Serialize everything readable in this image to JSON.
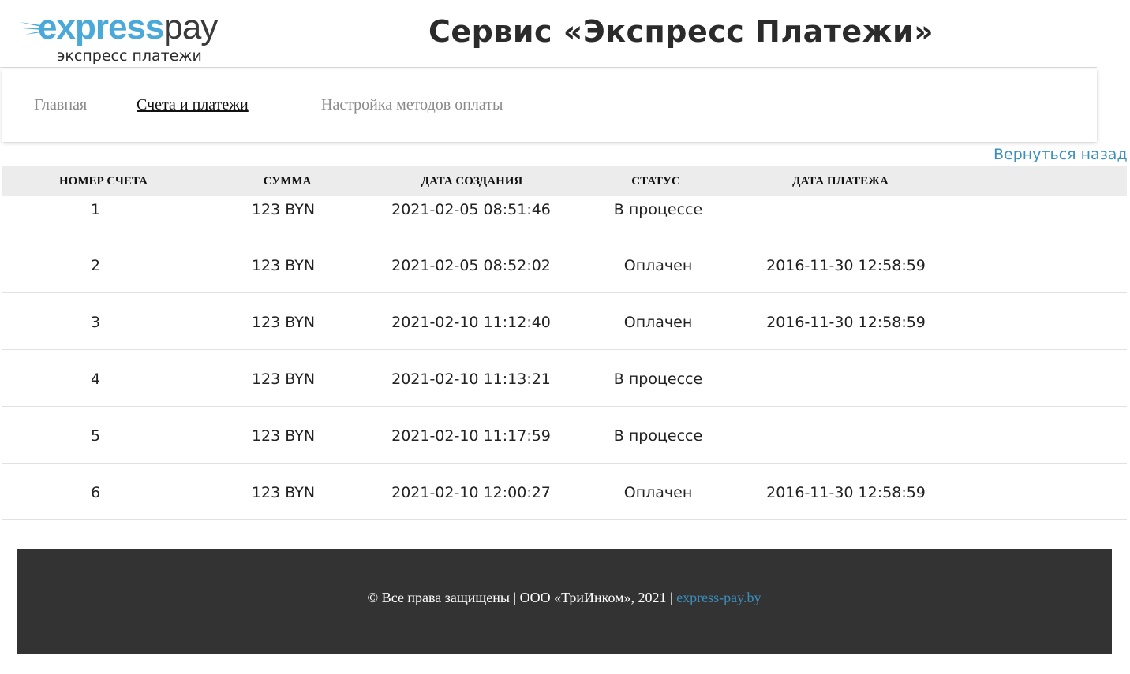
{
  "header": {
    "logo_word_1": "express",
    "logo_word_2": "pay",
    "logo_subtitle": "экспресс платежи",
    "title": "Сервис «Экспресс Платежи»"
  },
  "nav": {
    "items": [
      {
        "label": "Главная",
        "active": false
      },
      {
        "label": "Счета и платежи",
        "active": true
      },
      {
        "label": "Настройка методов оплаты",
        "active": false
      }
    ]
  },
  "back_link": "Вернуться назад",
  "table": {
    "columns": [
      "НОМЕР СЧЕТА",
      "СУММА",
      "ДАТА СОЗДАНИЯ",
      "СТАТУС",
      "ДАТА ПЛАТЕЖА"
    ],
    "rows": [
      [
        "1",
        "123 BYN",
        "2021-02-05 08:51:46",
        "В процессе",
        ""
      ],
      [
        "2",
        "123 BYN",
        "2021-02-05 08:52:02",
        "Оплачен",
        "2016-11-30 12:58:59"
      ],
      [
        "3",
        "123 BYN",
        "2021-02-10 11:12:40",
        "Оплачен",
        "2016-11-30 12:58:59"
      ],
      [
        "4",
        "123 BYN",
        "2021-02-10 11:13:21",
        "В процессе",
        ""
      ],
      [
        "5",
        "123 BYN",
        "2021-02-10 11:17:59",
        "В процессе",
        ""
      ],
      [
        "6",
        "123 BYN",
        "2021-02-10 12:00:27",
        "Оплачен",
        "2016-11-30 12:58:59"
      ]
    ]
  },
  "footer": {
    "text": "© Все права защищены | ООО «ТриИнком», 2021 | ",
    "link": "express-pay.by"
  },
  "colors": {
    "brand_blue": "#4aa9d8",
    "link_blue": "#3b8fbd",
    "footer_bg": "#333333",
    "table_header_bg": "#ececec"
  }
}
